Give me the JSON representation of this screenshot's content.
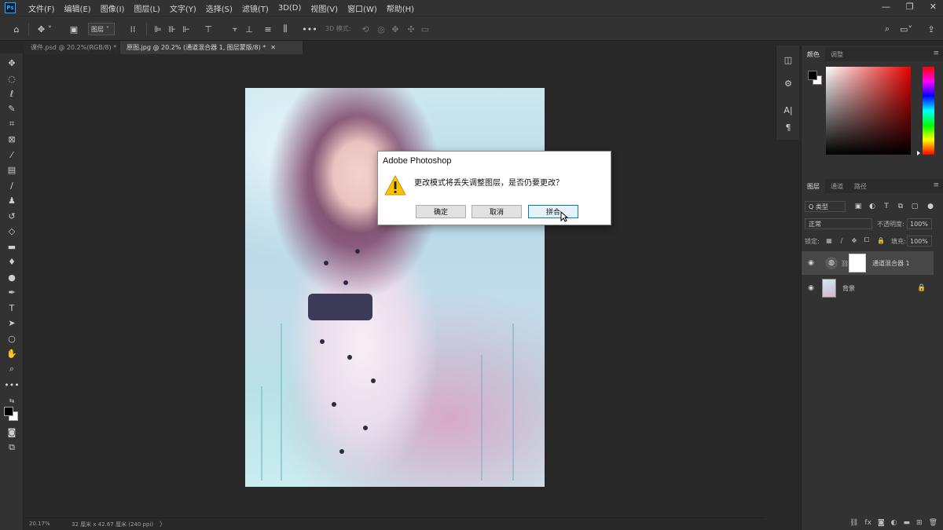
{
  "app": {
    "logo": "Ps"
  },
  "menu": [
    "文件(F)",
    "编辑(E)",
    "图像(I)",
    "图层(L)",
    "文字(Y)",
    "选择(S)",
    "滤镜(T)",
    "3D(D)",
    "视图(V)",
    "窗口(W)",
    "帮助(H)"
  ],
  "window_controls": {
    "minimize": "—",
    "restore": "❐",
    "close": "✕"
  },
  "options_bar": {
    "auto_select_target": "图层",
    "mode_3d_label": "3D 模式:"
  },
  "tabs": [
    {
      "label": "课件.psd @ 20.2%(RGB/8) *",
      "close": "✕"
    },
    {
      "label": "原图.jpg @ 20.2% (通道混合器 1, 图层蒙版/8) *",
      "close": "✕"
    }
  ],
  "status_bar": {
    "zoom": "20.17%",
    "doc_size": "32 厘米 x 42.67 厘米 (240 ppi)",
    "arrow": "〉"
  },
  "color_panel": {
    "tabs": [
      "颜色",
      "调整"
    ],
    "menu": "≡",
    "foreground": "#000000",
    "background": "#ffffff"
  },
  "layers_panel": {
    "tabs": [
      "图层",
      "通道",
      "路径"
    ],
    "menu": "≡",
    "kind_filter": "Q 类型",
    "blend_mode": "正常",
    "opacity_label": "不透明度:",
    "opacity_value": "100%",
    "lock_label": "锁定:",
    "fill_label": "填充:",
    "fill_value": "100%",
    "layers": [
      {
        "name": "通道混合器 1",
        "visible": true,
        "type": "adjustment"
      },
      {
        "name": "背景",
        "visible": true,
        "type": "background",
        "locked": true
      }
    ],
    "footer_icons": [
      "link-icon",
      "fx-icon",
      "mask-icon",
      "adjustment-icon",
      "folder-icon",
      "new-layer-icon",
      "trash-icon"
    ],
    "footer_fx": "fx"
  },
  "dialog": {
    "title": "Adobe Photoshop",
    "message": "更改模式将丢失调整图层，是否仍要更改？",
    "buttons": {
      "ok": "确定",
      "cancel": "取消",
      "flatten": "拼合"
    }
  }
}
